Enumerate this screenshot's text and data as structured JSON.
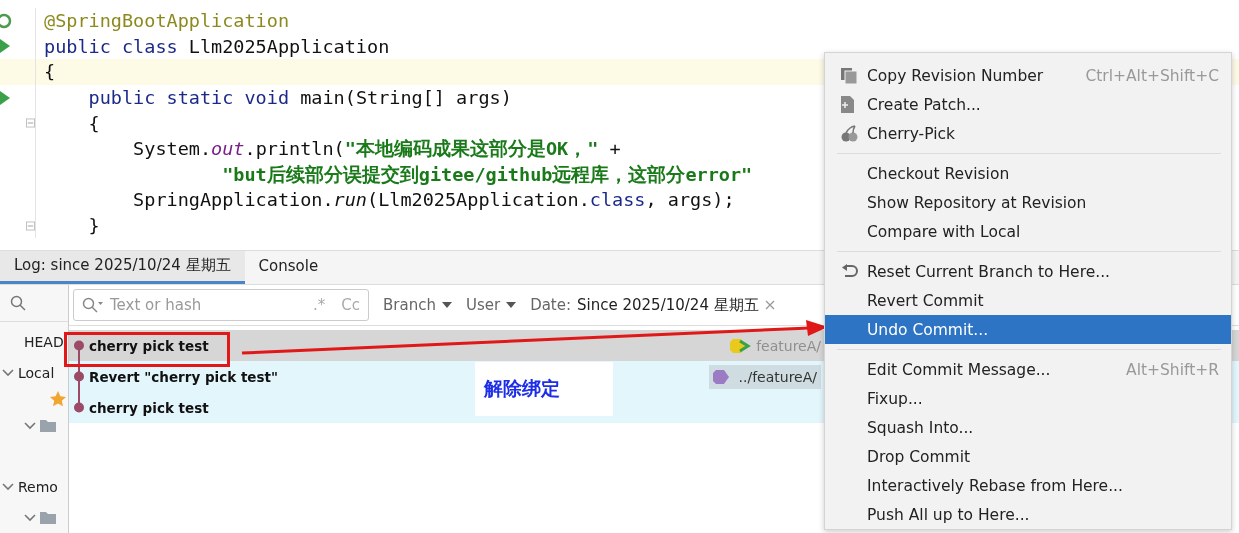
{
  "editor": {
    "lines": [
      {
        "kind": "spring",
        "current": false,
        "tokens": [
          {
            "text": "@SpringBootApplication",
            "kind": "annotation"
          }
        ]
      },
      {
        "kind": "run",
        "current": false,
        "tokens": [
          {
            "text": "public class ",
            "kind": "keyword"
          },
          {
            "text": "Llm2025Application",
            "kind": "plain"
          }
        ]
      },
      {
        "current": true,
        "tokens": [
          {
            "text": "{",
            "kind": "plain"
          }
        ]
      },
      {
        "kind": "run",
        "current": false,
        "tokens": [
          {
            "text": "    public static void ",
            "kind": "keyword"
          },
          {
            "text": "main(String[] args)",
            "kind": "plain"
          }
        ]
      },
      {
        "kind": "fold",
        "current": false,
        "tokens": [
          {
            "text": "    {",
            "kind": "plain"
          }
        ]
      },
      {
        "current": false,
        "tokens": [
          {
            "text": "        System.",
            "kind": "plain"
          },
          {
            "text": "out",
            "kind": "field"
          },
          {
            "text": ".println(",
            "kind": "plain"
          },
          {
            "text": "\"本地编码成果这部分是OK，\"",
            "kind": "string"
          },
          {
            "text": " +",
            "kind": "plain"
          }
        ]
      },
      {
        "current": false,
        "tokens": [
          {
            "text": "                \"but后续部分误提交到gitee/github远程库，这部分error\"",
            "kind": "string"
          }
        ]
      },
      {
        "current": false,
        "tokens": [
          {
            "text": "        SpringApplication.",
            "kind": "plain"
          },
          {
            "text": "run",
            "kind": "method"
          },
          {
            "text": "(Llm2025Application.",
            "kind": "plain"
          },
          {
            "text": "class",
            "kind": "keyword"
          },
          {
            "text": ", args);",
            "kind": "plain"
          }
        ]
      },
      {
        "kind": "fold",
        "current": false,
        "tokens": [
          {
            "text": "    }",
            "kind": "plain"
          }
        ]
      }
    ]
  },
  "tabs": [
    {
      "label": "Log: since 2025/10/24 星期五",
      "selected": true
    },
    {
      "label": "Console",
      "selected": false
    }
  ],
  "sidebar": {
    "items": [
      {
        "label": "HEAD",
        "kind": "ref"
      },
      {
        "label": "Local",
        "kind": "group",
        "expanded": true
      },
      {
        "kind": "star"
      },
      {
        "kind": "folder",
        "expanded": true
      },
      {
        "kind": "spacer"
      },
      {
        "label": "Remo",
        "kind": "group",
        "expanded": true
      },
      {
        "kind": "folder",
        "expanded": true
      }
    ]
  },
  "filters": {
    "search": {
      "placeholder": "Text or hash",
      "regex": ".*",
      "case": "Cc"
    },
    "branch": "Branch",
    "user": "User",
    "date_label": "Date:",
    "date_value": "Since 2025/10/24 星期五"
  },
  "commits": [
    {
      "message": "cherry pick test",
      "selected": true,
      "tag": "featureA/",
      "kind": "head"
    },
    {
      "message": "Revert \"cherry pick test\"",
      "selected": false,
      "tag": "../featureA/",
      "kind": "branch"
    },
    {
      "message": "cherry pick test",
      "selected": false
    }
  ],
  "annotation": {
    "text": "解除绑定"
  },
  "menu": {
    "groups": [
      [
        {
          "label": "Copy Revision Number",
          "shortcut": "Ctrl+Alt+Shift+C",
          "kind": "copy",
          "selected": false
        },
        {
          "label": "Create Patch...",
          "kind": "patch",
          "selected": false
        },
        {
          "label": "Cherry-Pick",
          "kind": "cherry",
          "selected": false
        }
      ],
      [
        {
          "label": "Checkout Revision",
          "selected": false
        },
        {
          "label": "Show Repository at Revision",
          "selected": false
        },
        {
          "label": "Compare with Local",
          "selected": false
        }
      ],
      [
        {
          "label": "Reset Current Branch to Here...",
          "kind": "undo",
          "selected": false
        },
        {
          "label": "Revert Commit",
          "selected": false
        },
        {
          "label": "Undo Commit...",
          "selected": true
        }
      ],
      [
        {
          "label": "Edit Commit Message...",
          "shortcut": "Alt+Shift+R",
          "selected": false
        },
        {
          "label": "Fixup...",
          "selected": false
        },
        {
          "label": "Squash Into...",
          "selected": false
        },
        {
          "label": "Drop Commit",
          "selected": false
        },
        {
          "label": "Interactively Rebase from Here...",
          "selected": false
        },
        {
          "label": "Push All up to Here...",
          "selected": false
        }
      ]
    ]
  }
}
